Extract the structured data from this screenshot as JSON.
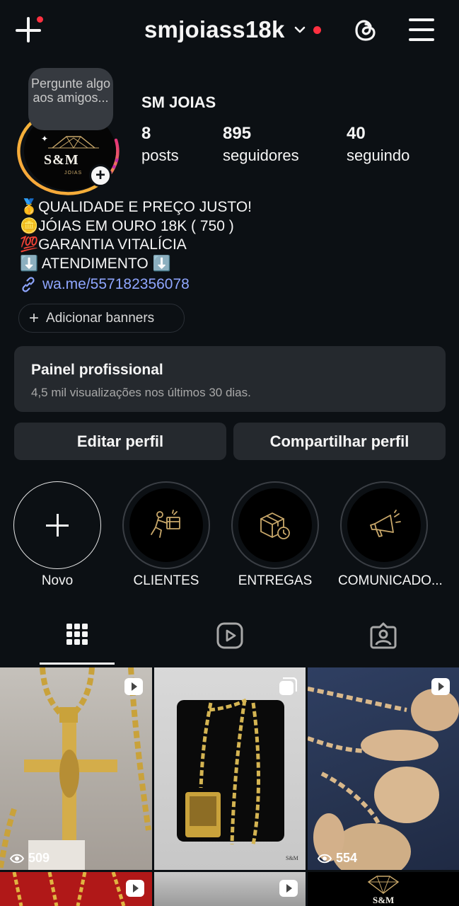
{
  "header": {
    "username": "smjoiass18k",
    "icons": [
      "create-plus-icon",
      "chevron-down-icon",
      "threads-icon",
      "menu-icon"
    ]
  },
  "profile": {
    "display_name": "SM JOIAS",
    "note_bubble": "Pergunte algo aos amigos...",
    "avatar_logo": "S&M",
    "avatar_sub": "JOIAS",
    "stats": [
      {
        "value": "8",
        "label": "posts"
      },
      {
        "value": "895",
        "label": "seguidores"
      },
      {
        "value": "40",
        "label": "seguindo"
      }
    ]
  },
  "bio": {
    "lines": [
      "🥇QUALIDADE E PREÇO JUSTO!",
      "🪙JÓIAS EM OURO 18K ( 750 )",
      "💯GARANTIA VITALÍCIA",
      "⬇️ ATENDIMENTO ⬇️"
    ],
    "link": "wa.me/557182356078"
  },
  "banners_button": "Adicionar banners",
  "dashboard": {
    "title": "Painel profissional",
    "subtitle": "4,5 mil visualizações nos últimos 30 dias."
  },
  "actions": {
    "edit": "Editar perfil",
    "share": "Compartilhar perfil"
  },
  "highlights": [
    {
      "label": "Novo",
      "icon": "plus-icon"
    },
    {
      "label": "CLIENTES",
      "icon": "delivery-person-icon"
    },
    {
      "label": "ENTREGAS",
      "icon": "package-clock-icon"
    },
    {
      "label": "COMUNICADO...",
      "icon": "megaphone-icon"
    }
  ],
  "tabs": [
    {
      "name": "grid",
      "icon": "grid-icon"
    },
    {
      "name": "reels",
      "icon": "reels-icon"
    },
    {
      "name": "tagged",
      "icon": "tagged-icon"
    }
  ],
  "posts": [
    {
      "type": "reel",
      "views": "509"
    },
    {
      "type": "carousel",
      "watermark": "S&M"
    },
    {
      "type": "reel",
      "views": "554"
    },
    {
      "type": "reel"
    },
    {
      "type": "reel"
    },
    {
      "type": "image",
      "watermark": "S&M"
    }
  ],
  "colors": {
    "background": "#0c1014",
    "card": "#25292e",
    "link": "#8fa6ff",
    "notification": "#ff3040",
    "gold": "#c9a86a"
  }
}
